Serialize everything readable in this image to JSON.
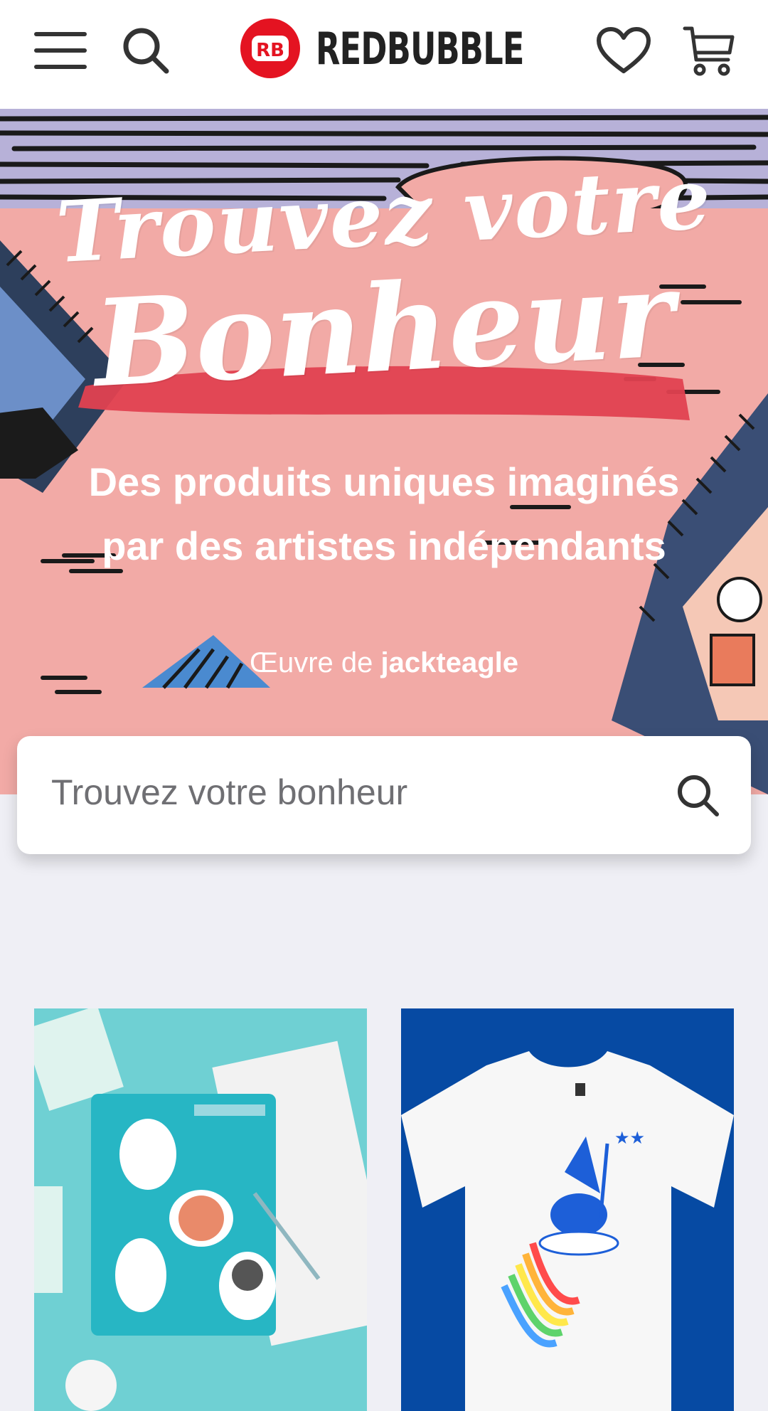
{
  "header": {
    "logo_text": "REDBUBBLE",
    "icons": [
      "menu-icon",
      "search-icon",
      "heart-icon",
      "cart-icon"
    ]
  },
  "hero": {
    "title_line1": "Trouvez votre",
    "title_line2": "Bonheur",
    "subtitle": "Des produits uniques imaginés par des artistes indépendants",
    "credit_prefix": "Œuvre de",
    "credit_artist": "jackteagle"
  },
  "search": {
    "placeholder": "Trouvez votre bonheur"
  },
  "colors": {
    "brand": "#e41321",
    "hero_bg": "#f2aaa6",
    "page_bg": "#efeff5",
    "card1_bg": "#6fd0d3",
    "card2_bg": "#064aa3"
  }
}
